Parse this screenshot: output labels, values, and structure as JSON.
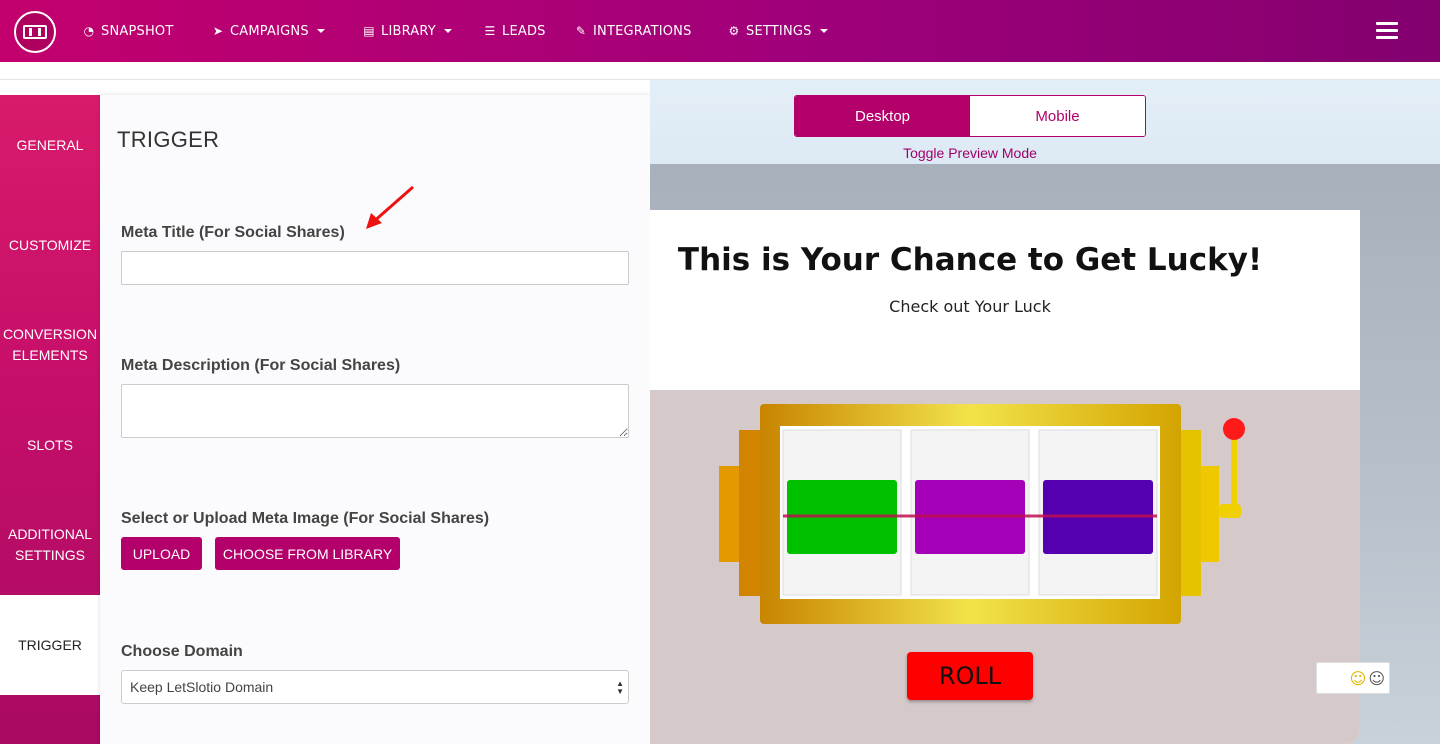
{
  "nav": {
    "items": [
      {
        "label": "SNAPSHOT",
        "icon": "dashboard-icon",
        "dropdown": false
      },
      {
        "label": "CAMPAIGNS",
        "icon": "paper-plane-icon",
        "dropdown": true
      },
      {
        "label": "LIBRARY",
        "icon": "library-icon",
        "dropdown": true
      },
      {
        "label": "LEADS",
        "icon": "list-icon",
        "dropdown": false
      },
      {
        "label": "INTEGRATIONS",
        "icon": "plug-icon",
        "dropdown": false
      },
      {
        "label": "SETTINGS",
        "icon": "gears-icon",
        "dropdown": true
      }
    ]
  },
  "sidebar": {
    "items": [
      {
        "label": "GENERAL"
      },
      {
        "label": "CUSTOMIZE"
      },
      {
        "label": "CONVERSION ELEMENTS"
      },
      {
        "label": "SLOTS"
      },
      {
        "label": "ADDITIONAL SETTINGS"
      },
      {
        "label": "TRIGGER",
        "active": true
      }
    ]
  },
  "panel": {
    "title": "TRIGGER",
    "meta_title_label": "Meta Title (For Social Shares)",
    "meta_title_value": "",
    "meta_description_label": "Meta Description (For Social Shares)",
    "meta_description_value": "",
    "meta_image_label": "Select or Upload Meta Image (For Social Shares)",
    "upload_button": "UPLOAD",
    "library_button": "CHOOSE FROM LIBRARY",
    "domain_label": "Choose Domain",
    "domain_selected": "Keep LetSlotio Domain"
  },
  "preview": {
    "desktop_label": "Desktop",
    "mobile_label": "Mobile",
    "toggle_caption": "Toggle Preview Mode",
    "title": "This is Your Chance to Get Lucky!",
    "subtitle": "Check out Your Luck",
    "roll_label": "ROLL",
    "slot_colors": [
      "#00c000",
      "#a300b8",
      "#5400b0"
    ]
  },
  "colors": {
    "brand": "#b3006b",
    "annotation_arrow": "#ee1111"
  }
}
